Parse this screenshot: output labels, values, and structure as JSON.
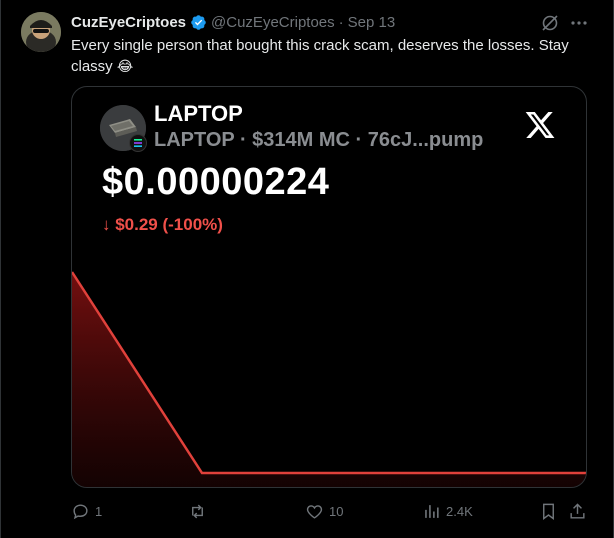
{
  "post": {
    "display_name": "CuzEyeCriptoes",
    "handle": "@CuzEyeCriptoes",
    "separator": "·",
    "date": "Sep 13",
    "text": "Every single person that bought this crack scam, deserves the losses.  Stay classy",
    "emoji": "😂"
  },
  "card": {
    "token_name": "LAPTOP",
    "token_sub": "LAPTOP · $314M MC · 76cJ...pump",
    "price": "$0.00000224",
    "change": "↓ $0.29 (-100%)",
    "colors": {
      "loss": "#f0504a",
      "line": "#e0413b"
    }
  },
  "chart_data": {
    "type": "area",
    "x": [
      0,
      1,
      2,
      3
    ],
    "values": [
      0.29,
      0.0,
      0.0,
      0.0
    ],
    "title": "",
    "xlabel": "",
    "ylabel": ""
  },
  "actions": {
    "replies": "1",
    "retweets": "",
    "likes": "10",
    "views": "2.4K"
  },
  "icons": [
    "verified-badge-icon",
    "grok-icon",
    "more-icon",
    "x-logo-icon",
    "reply-icon",
    "retweet-icon",
    "like-icon",
    "views-icon",
    "bookmark-icon",
    "share-icon"
  ]
}
